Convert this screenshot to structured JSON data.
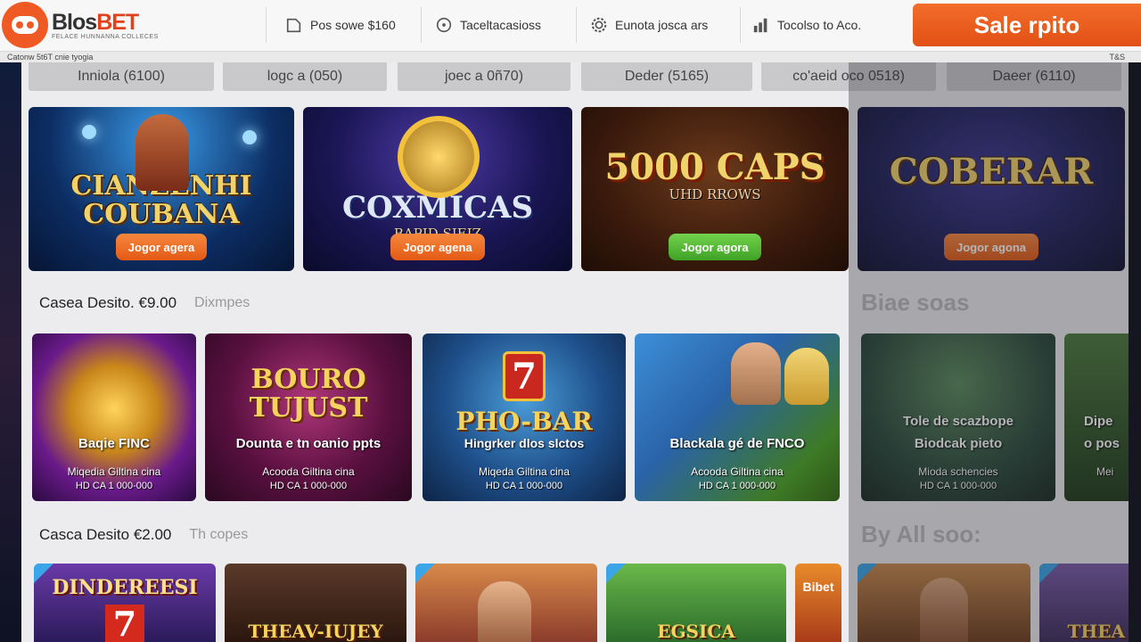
{
  "header": {
    "logo_text_a": "Blos",
    "logo_text_b": "BET",
    "logo_tagline": "FELACE HUNNANNA COLLECES",
    "nav": [
      {
        "label": "Pos sowe $160",
        "icon": "document-icon"
      },
      {
        "label": "Taceltacasioss",
        "icon": "dice-icon"
      },
      {
        "label": "Eunota josca ars",
        "icon": "settings-icon"
      },
      {
        "label": "Tocolso to Aco.",
        "icon": "chart-icon"
      }
    ],
    "cta_label": "Sale rpito"
  },
  "subbar": {
    "left_text": "Catonw 5t6T cnie tyogia",
    "right_text": "T&S"
  },
  "categories": [
    "Inniola (6100)",
    "logc a (050)",
    "joec a 0ñ70)",
    "Deder (5165)",
    "co'aeid oco 0518)",
    "Daeer (6110)"
  ],
  "banners": [
    {
      "title": "CIANZENHI COUBANA",
      "sub": "",
      "button": "Jogor agera",
      "button_style": "orange"
    },
    {
      "title": "COXMICAS",
      "sub": "BAPID SIEIZ",
      "button": "Jogor agena",
      "button_style": "orange"
    },
    {
      "title": "5000 CAPS",
      "sub": "UHD RROWS",
      "button": "Jogor agora",
      "button_style": "green"
    },
    {
      "title": "COBERAR",
      "sub": "",
      "button": "Jogor agona",
      "button_style": "orange"
    }
  ],
  "section1": {
    "title": "Casea Desito. €9.00",
    "aside": "Dixmpes",
    "side_title": "Biae soas"
  },
  "cards": [
    {
      "logo": "",
      "name": "Baqie FINC",
      "line1": "Miqedia Giltina cina",
      "line2": "HD CA 1 000-000"
    },
    {
      "logo": "BOURO TUJUST",
      "name": "Dounta e tn oanio ppts",
      "line1": "Acooda Giltina cina",
      "line2": "HD CA 1 000-000"
    },
    {
      "logo": "PHO-BAR",
      "name": "Hingrker dlos slctos",
      "line1": "Miqeda Giltina cina",
      "line2": "HD CA 1 000-000"
    },
    {
      "logo": "",
      "name": "Blackala gé de FNCO",
      "line1": "Acooda Giltina cina",
      "line2": "HD CA 1 000-000"
    },
    {
      "logo": "",
      "name": "Tole de scazbope",
      "line1": "Mioda schencies",
      "line2": "HD CA 1 000-000"
    },
    {
      "logo": "",
      "name": "Dipe",
      "line1": "Mei",
      "line2": ""
    }
  ],
  "card_sub_name2": "Biodcak pieto",
  "card_sub_name6": "o pos",
  "section2": {
    "title": "Casca Desito €2.00",
    "aside": "Th copes",
    "side_title": "By All soo:"
  },
  "tiles": [
    {
      "label": "DINDEREESI"
    },
    {
      "label": "THEAV-IUJEY"
    },
    {
      "label": ""
    },
    {
      "label": "EGSICA"
    },
    {
      "label": "Bibet"
    },
    {
      "label": ""
    },
    {
      "label": "THEA"
    }
  ],
  "colors": {
    "accent": "#e8571b",
    "green": "#4cb52e",
    "panel": "#ececee"
  }
}
